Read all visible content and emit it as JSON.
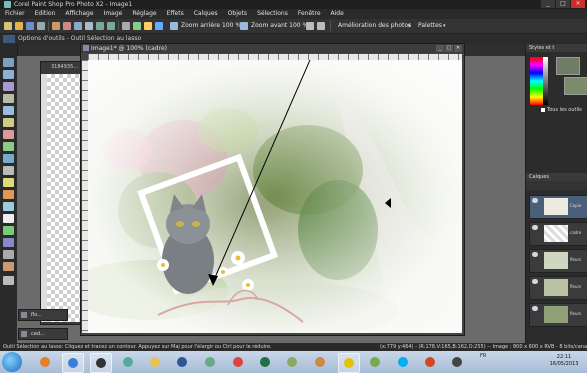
{
  "window": {
    "title": "Corel Paint Shop Pro Photo X2 - Image1",
    "controls": [
      "_",
      "□",
      "✕"
    ]
  },
  "menu": [
    "Fichier",
    "Edition",
    "Affichage",
    "Image",
    "Réglage",
    "Effets",
    "Calques",
    "Objets",
    "Sélections",
    "Fenêtre",
    "Aide"
  ],
  "toolbar": {
    "zoom_in": "Zoom arrière 100 %",
    "zoom_out": "Zoom avant 100 %",
    "photo_improve": "Amélioration des photos",
    "palettes": "Palettes"
  },
  "tool_options": {
    "label": "Options d'outils - Outil Sélection au lasso"
  },
  "image_window": {
    "title": "Image1* @ 100% (cadre)",
    "buttons": [
      "_",
      "□",
      "✕"
    ]
  },
  "back_window": {
    "title": "3184935…"
  },
  "minimized": [
    {
      "label": "flo..."
    },
    {
      "label": "cad..."
    }
  ],
  "panels": {
    "styles_title": "Styles et t",
    "all_tools": "Tous les outils",
    "layers_title": "Calques",
    "layers": [
      {
        "name": "Copie"
      },
      {
        "name": "cadre"
      },
      {
        "name": "fleurs"
      },
      {
        "name": "fleurs"
      },
      {
        "name": "fleurs"
      }
    ]
  },
  "status": {
    "left": "Outil Sélection au lasso: Cliquez et tracez un contour. Appuyez sur Maj pour l'élargir ou Ctrl pour le réduire.",
    "right": "(x:779 y:464) - (R:178,V:165,B:162,O:255) -- Image : 800 x 600 x RVB - 8 bits/canal"
  },
  "taskbar": {
    "lang": "FR",
    "time": "22:11",
    "date": "16/05/2013",
    "apps": [
      "ie",
      "folder",
      "media",
      "word",
      "excel",
      "chrome",
      "skype",
      "psp"
    ]
  },
  "colors": {
    "accent": "#3d5a7a",
    "fg_swatch": "#6e7d64",
    "bg_swatch": "#7b8c6a"
  }
}
